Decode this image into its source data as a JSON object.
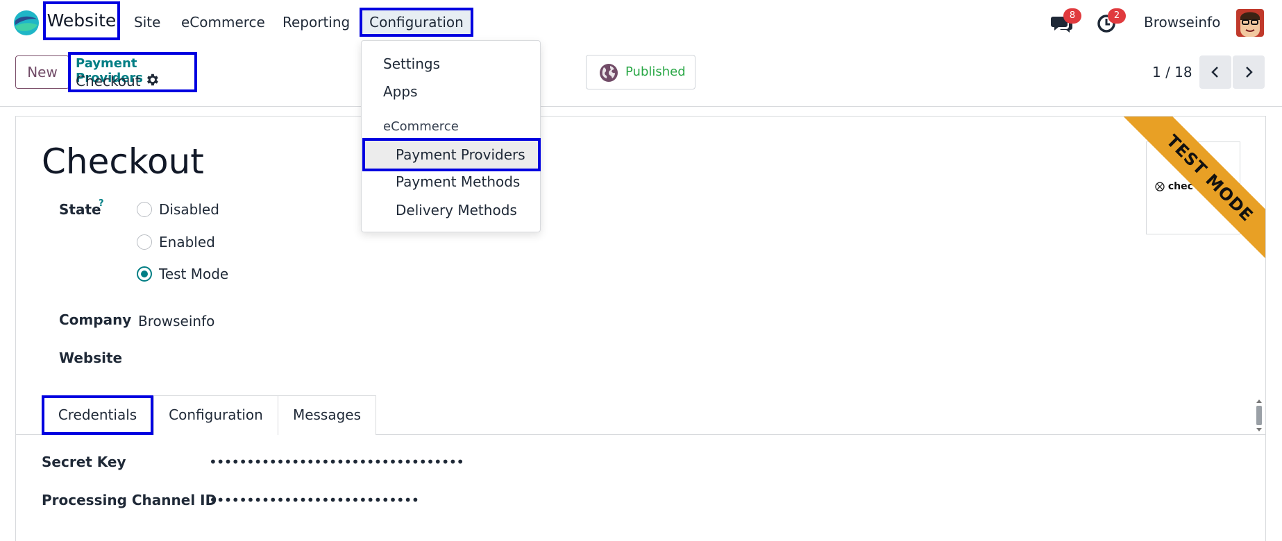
{
  "navbar": {
    "app_name": "Website",
    "menu": [
      "Site",
      "eCommerce",
      "Reporting",
      "Configuration"
    ],
    "messages_count": "8",
    "activities_count": "2",
    "user_name": "Browseinfo"
  },
  "control_panel": {
    "new_label": "New",
    "breadcrumb_parent": "Payment Providers",
    "breadcrumb_current": "Checkout",
    "published_label": "Published",
    "pager_value": "1 / 18"
  },
  "dropdown": {
    "items": [
      "Settings",
      "Apps"
    ],
    "section_header": "eCommerce",
    "section_items": [
      "Payment Providers",
      "Payment Methods",
      "Delivery Methods"
    ],
    "active_item": "Payment Providers"
  },
  "form": {
    "title": "Checkout",
    "state_label": "State",
    "state_help": "?",
    "state_options": [
      "Disabled",
      "Enabled",
      "Test Mode"
    ],
    "state_selected": "Test Mode",
    "company_label": "Company",
    "company_value": "Browseinfo",
    "website_label": "Website",
    "website_value": "",
    "ribbon_text": "TEST MODE",
    "provider_logo_text": "chec"
  },
  "tabs": [
    "Credentials",
    "Configuration",
    "Messages"
  ],
  "active_tab": "Credentials",
  "credentials": {
    "secret_key_label": "Secret Key",
    "secret_key_value": "••••••••••••••••••••••••••••••••••",
    "channel_label": "Processing Channel ID",
    "channel_value": "••••••••••••••••••••••••••••"
  },
  "colors": {
    "highlight_border": "#0000e0",
    "brand_purple": "#714b67",
    "teal": "#017e84",
    "published_green": "#28a745",
    "ribbon": "#e8a025",
    "badge_red": "#e03a3e"
  }
}
